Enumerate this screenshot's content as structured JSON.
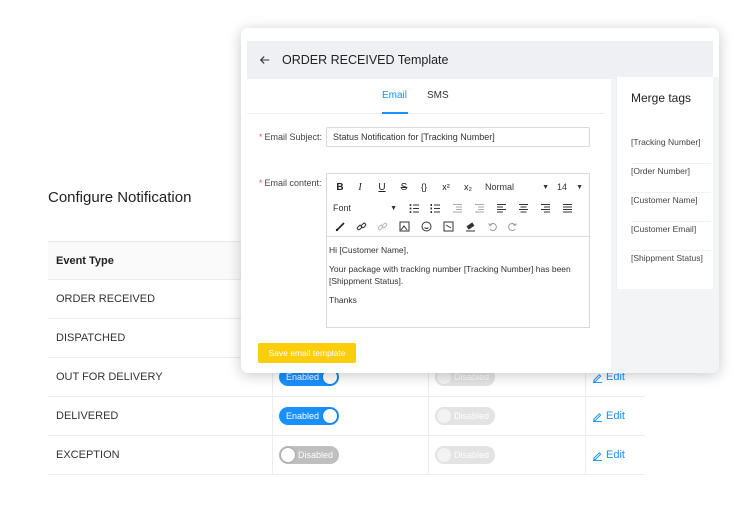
{
  "page": {
    "title": "Configure Notification",
    "table": {
      "header": "Event Type",
      "rows": [
        {
          "event": "ORDER RECEIVED",
          "email_toggle": "",
          "sms_toggle": "",
          "action": ""
        },
        {
          "event": "DISPATCHED",
          "email_toggle": "",
          "sms_toggle": "",
          "action": ""
        },
        {
          "event": "OUT FOR DELIVERY",
          "email_toggle": "Enabled",
          "sms_toggle": "Disabled",
          "action": "Edit"
        },
        {
          "event": "DELIVERED",
          "email_toggle": "Enabled",
          "sms_toggle": "Disabled",
          "action": "Edit"
        },
        {
          "event": "EXCEPTION",
          "email_toggle": "Disabled",
          "sms_toggle": "Disabled",
          "action": "Edit"
        }
      ]
    }
  },
  "modal": {
    "title": "ORDER RECEIVED Template",
    "tabs": [
      "Email",
      "SMS"
    ],
    "active_tab": "Email",
    "subject_label": "Email Subject",
    "subject_value": "Status Notification for [Tracking Number]",
    "content_label": "Email content",
    "toolbar": {
      "header_select": "Normal",
      "size_select": "14",
      "font_select": "Font"
    },
    "body": {
      "line1": "Hi  [Customer Name],",
      "line2": "Your package with tracking number  [Tracking Number] has been [Shippment Status].",
      "line3": "Thanks"
    },
    "save_label": "Save email template",
    "merge_tags": {
      "title": "Merge tags",
      "items": [
        "[Tracking Number]",
        "[Order Number]",
        "[Customer Name]",
        "[Customer Email]",
        "[Shippment Status]"
      ]
    }
  },
  "colors": {
    "accent": "#1890ff",
    "save_button": "#fcce0a",
    "required": "#ff4d4f"
  }
}
